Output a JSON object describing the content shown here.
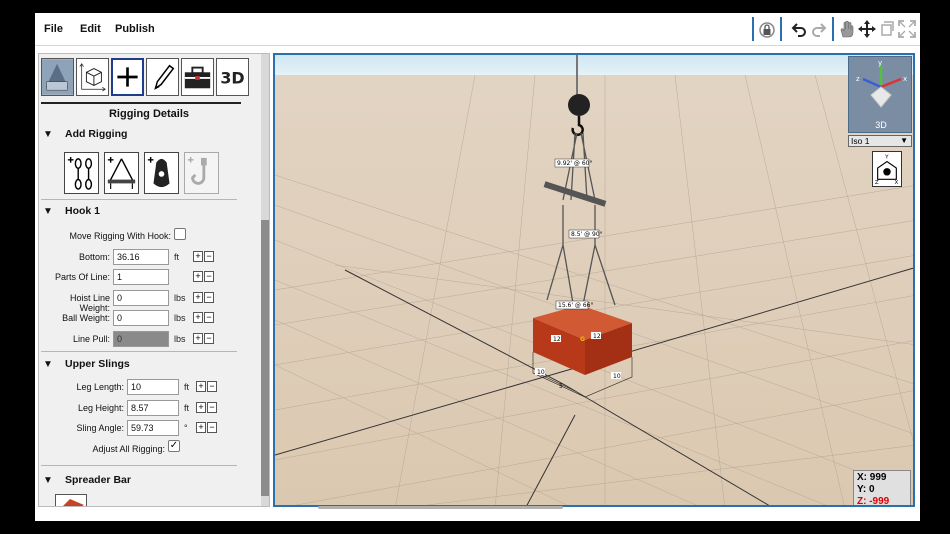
{
  "menus": [
    "File",
    "Edit",
    "Publish"
  ],
  "toolbar_icons": [
    "lock-icon",
    "undo-icon",
    "redo-icon",
    "hand-icon",
    "move-icon",
    "rotate-icon",
    "fullscreen-icon"
  ],
  "tools": {
    "selected": "add",
    "label_3d": "3D"
  },
  "panel": {
    "title": "Rigging Details",
    "add_rigging": {
      "header": "Add Rigging"
    },
    "hook": {
      "header": "Hook 1",
      "move_label": "Move Rigging With Hook:",
      "fields": [
        {
          "label": "Bottom:",
          "value": "36.16",
          "unit": "ft"
        },
        {
          "label": "Parts Of Line:",
          "value": "1",
          "unit": ""
        },
        {
          "label": "Hoist Line Weight:",
          "value": "0",
          "unit": "lbs"
        },
        {
          "label": "Ball Weight:",
          "value": "0",
          "unit": "lbs"
        },
        {
          "label": "Line Pull:",
          "value": "0",
          "unit": "lbs"
        }
      ]
    },
    "upper_slings": {
      "header": "Upper Slings",
      "fields": [
        {
          "label": "Leg Length:",
          "value": "10",
          "unit": "ft"
        },
        {
          "label": "Leg Height:",
          "value": "8.57",
          "unit": "ft"
        },
        {
          "label": "Sling Angle:",
          "value": "59.73",
          "unit": "°"
        }
      ],
      "adjust_label": "Adjust All Rigging:",
      "adjust_checked": "✓"
    },
    "spreader_bar": {
      "header": "Spreader Bar"
    }
  },
  "viewport": {
    "view_cube_label": "3D",
    "view_select": "Iso 1",
    "coords": {
      "x": "X: 999",
      "y": "Y: 0",
      "z": "Z: -999"
    },
    "annotations": {
      "top_sling": "9.92' @ 60°",
      "lower_sling": "8.5' @ 90°",
      "base_sling": "15.6' @ 66°",
      "box_left": "12",
      "box_right": "12",
      "box_front_left": "10",
      "box_front_right": "10",
      "box_height": "5",
      "cg": "G"
    }
  },
  "colors": {
    "accent": "#2a6fb0",
    "load_box": "#c8431f",
    "section_rule": "#9fd35a",
    "ground": "#dfccb3"
  }
}
